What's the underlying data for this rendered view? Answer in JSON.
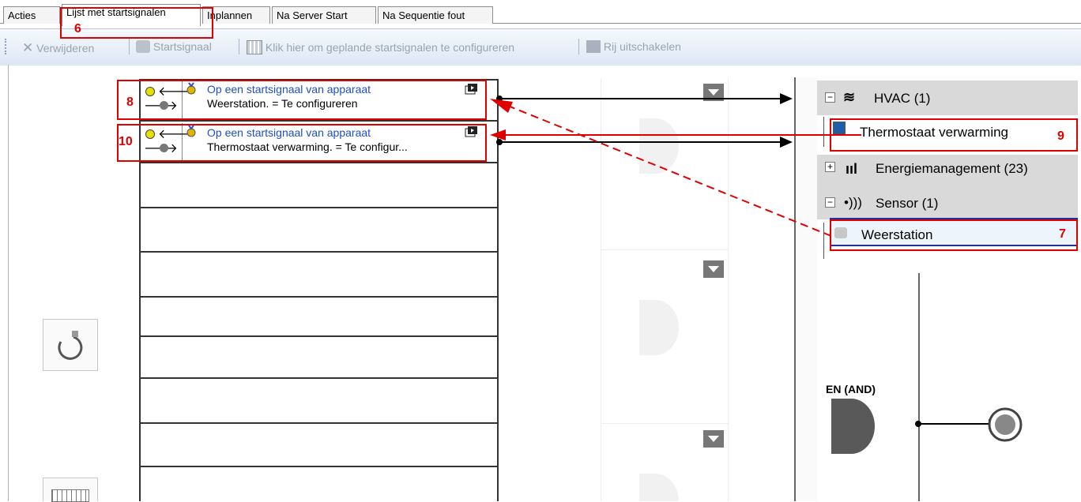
{
  "tabs": [
    "Acties",
    "Lijst met startsignalen",
    "Inplannen",
    "Na Server Start",
    "Na Sequentie fout"
  ],
  "toolbar": {
    "delete": "Verwijderen",
    "startsignal": "Startsignaal",
    "configure": "Klik hier om geplande startsignalen te configureren",
    "disable_row": "Rij uitschakelen"
  },
  "triggers": [
    {
      "title": "Op een startsignaal van apparaat",
      "detail": "Weerstation. = Te configureren"
    },
    {
      "title": "Op een startsignaal van apparaat",
      "detail": "Thermostaat verwarming. = Te configur..."
    }
  ],
  "tree": {
    "hvac": "HVAC (1)",
    "thermostat": "Thermostaat verwarming",
    "energy": "Energiemanagement (23)",
    "sensor": "Sensor (1)",
    "weather": "Weerstation"
  },
  "gate_label": "EN (AND)",
  "callouts": {
    "c6": "6",
    "c7": "7",
    "c8": "8",
    "c9": "9",
    "c10": "10"
  },
  "colors": {
    "accent_red": "#e00000",
    "link_blue": "#1f4fc1",
    "selection_blue": "#1f2f9f"
  }
}
